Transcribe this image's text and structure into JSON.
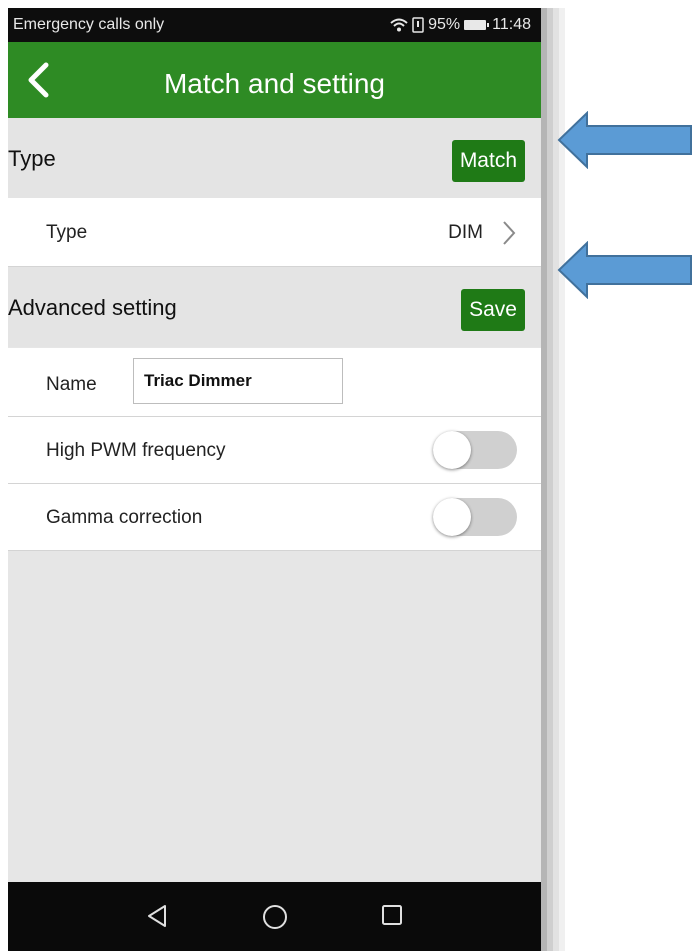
{
  "status_bar": {
    "carrier": "Emergency calls only",
    "battery_percent": "95%",
    "time": "11:48",
    "icons": [
      "wifi-icon",
      "data-icon",
      "battery-icon"
    ]
  },
  "app_bar": {
    "title": "Match and setting",
    "back_icon": "back-arrow-icon",
    "color": "#2e8b24"
  },
  "type_section": {
    "header": "Type",
    "match_label": "Match",
    "row_label": "Type",
    "row_value": "DIM"
  },
  "advanced_section": {
    "header": "Advanced setting",
    "save_label": "Save",
    "name_label": "Name",
    "name_value": "Triac Dimmer",
    "toggles": [
      {
        "label": "High PWM frequency",
        "on": false
      },
      {
        "label": "Gamma correction",
        "on": false
      }
    ]
  },
  "nav_bar": {
    "buttons": [
      "back-triangle-icon",
      "home-circle-icon",
      "recents-square-icon"
    ]
  },
  "annotations": {
    "arrow_color": "#5b9bd5",
    "arrows": [
      "match-pointer-arrow",
      "save-pointer-arrow"
    ]
  }
}
